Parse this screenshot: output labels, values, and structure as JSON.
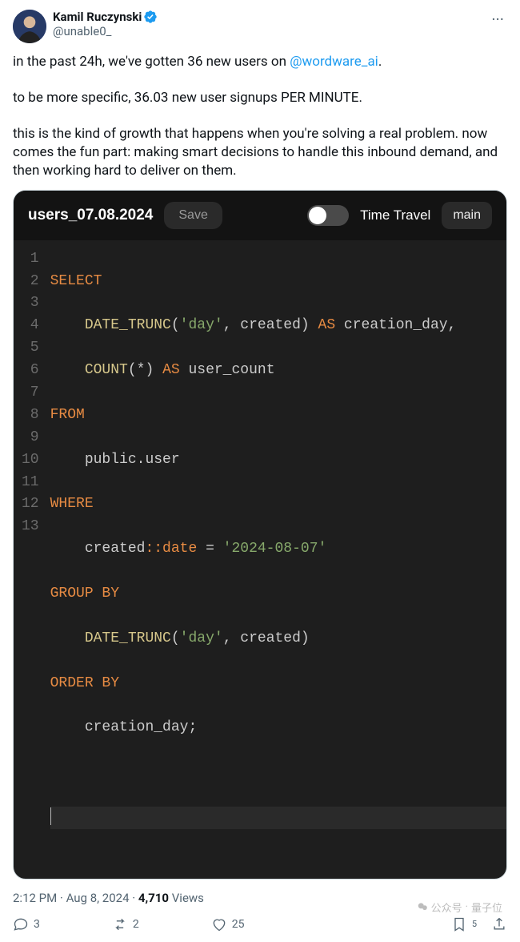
{
  "author": {
    "name": "Kamil Ruczynski",
    "handle": "@unable0_"
  },
  "body": {
    "p1_a": "in the past 24h, we've gotten 36 new users on ",
    "p1_mention": "@wordware_ai",
    "p1_b": ".",
    "p2": "to be more specific, 36.03 new user signups PER MINUTE.",
    "p3": "this is the kind of growth that happens when you're solving a real problem. now comes the fun part: making smart decisions to handle this inbound demand, and then working hard to deliver on them."
  },
  "media": {
    "title": "users_07.08.2024",
    "save": "Save",
    "time_travel": "Time Travel",
    "branch": "main",
    "lines": [
      "1",
      "2",
      "3",
      "4",
      "5",
      "6",
      "7",
      "8",
      "9",
      "10",
      "11",
      "12",
      "13"
    ],
    "code": {
      "l1_kw": "SELECT",
      "l2_func": "DATE_TRUNC",
      "l2_str": "'day'",
      "l2_rest1": "(",
      "l2_rest2": ", created) ",
      "l2_as": "AS",
      "l2_alias": " creation_day,",
      "l3_func": "COUNT",
      "l3_arg": "(*) ",
      "l3_as": "AS",
      "l3_alias": " user_count",
      "l4_kw": "FROM",
      "l5_id": "public.user",
      "l6_kw": "WHERE",
      "l7_id": "created",
      "l7_cast": "::date",
      "l7_eq": " = ",
      "l7_str": "'2024-08-07'",
      "l8_kw": "GROUP BY",
      "l9_func": "DATE_TRUNC",
      "l9_args1": "(",
      "l9_str": "'day'",
      "l9_args2": ", created)",
      "l10_kw": "ORDER BY",
      "l11_id": "creation_day;"
    }
  },
  "meta": {
    "time": "2:12 PM",
    "sep1": " · ",
    "date": "Aug 8, 2024",
    "sep2": " · ",
    "views_count": "4,710",
    "views_label": " Views"
  },
  "actions": {
    "replies": "3",
    "retweets": "2",
    "likes": "25",
    "bookmarks": "5"
  },
  "watermark": {
    "label": "公众号",
    "sub": "量子位"
  }
}
